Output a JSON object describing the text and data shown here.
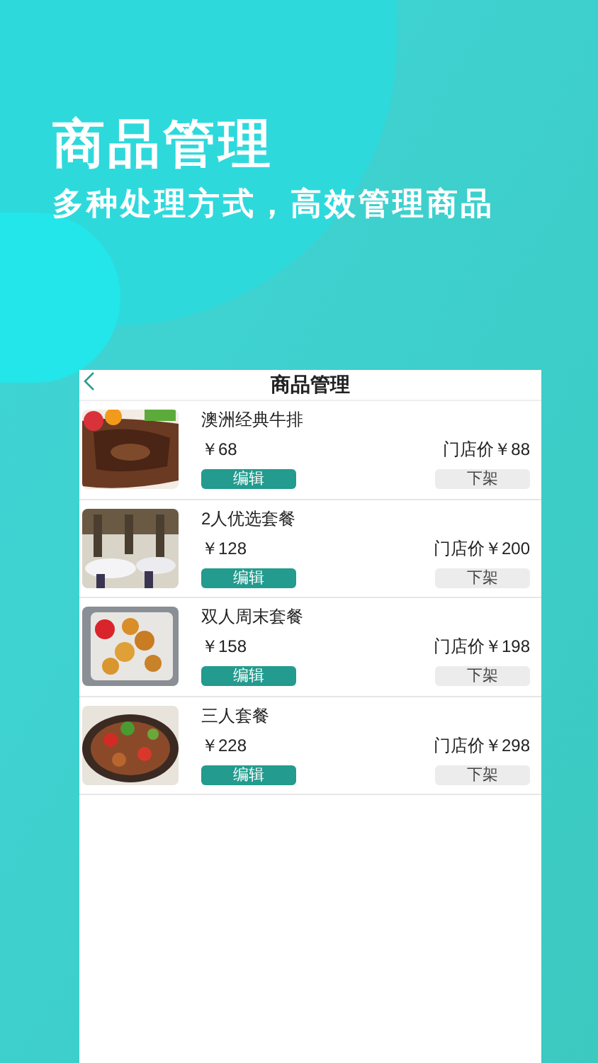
{
  "headline": "商品管理",
  "subtitle": "多种处理方式，高效管理商品",
  "screen": {
    "title": "商品管理",
    "products": [
      {
        "name": "澳洲经典牛排",
        "price": "￥68",
        "store_price": "门店价￥88",
        "edit_button": "编辑",
        "delist_button": "下架"
      },
      {
        "name": "2人优选套餐",
        "price": "￥128",
        "store_price": "门店价￥200",
        "edit_button": "编辑",
        "delist_button": "下架"
      },
      {
        "name": "双人周末套餐",
        "price": "￥158",
        "store_price": "门店价￥198",
        "edit_button": "编辑",
        "delist_button": "下架"
      },
      {
        "name": "三人套餐",
        "price": "￥228",
        "store_price": "门店价￥298",
        "edit_button": "编辑",
        "delist_button": "下架"
      }
    ]
  }
}
